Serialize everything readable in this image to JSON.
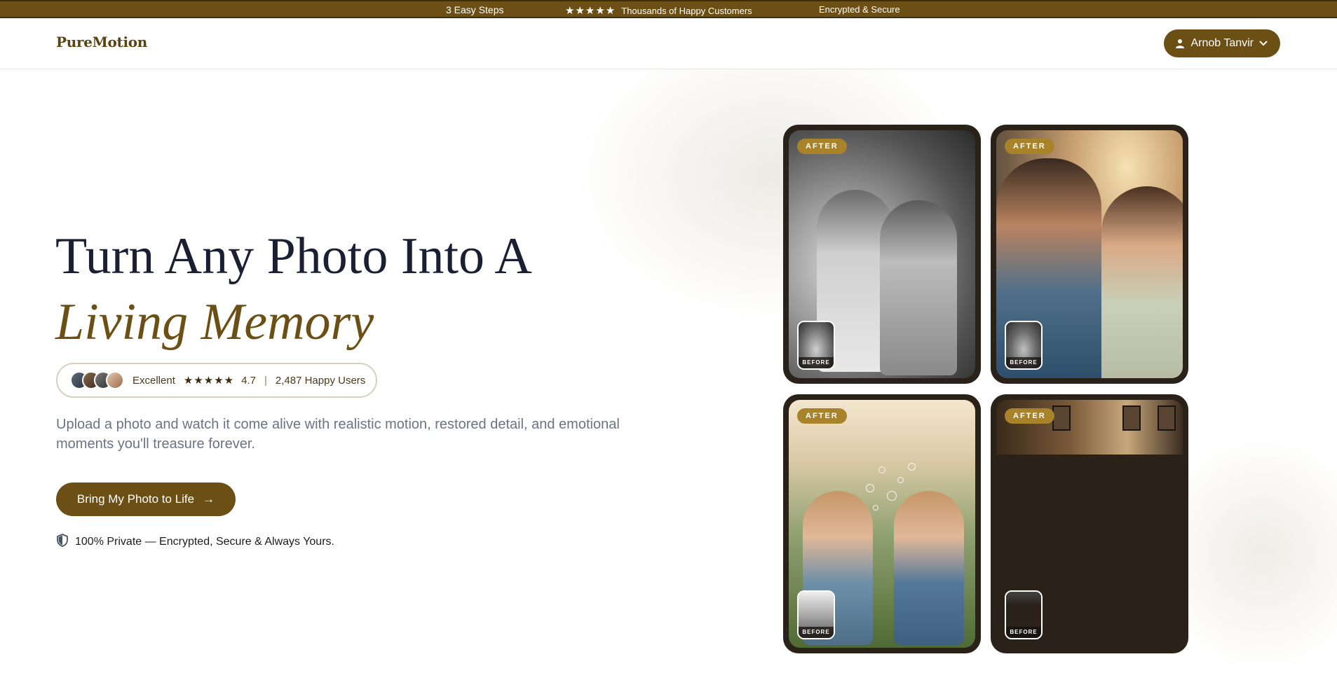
{
  "topbar": {
    "steps": "3 Easy Steps",
    "stars": "★★★★★",
    "customers": "Thousands of Happy Customers",
    "secure": "Encrypted & Secure"
  },
  "header": {
    "logo": "PureMotion",
    "user_name": "Arnob Tanvir"
  },
  "hero": {
    "headline_line1": "Turn Any Photo Into A",
    "headline_line2": "Living Memory",
    "rating": {
      "label": "Excellent",
      "stars": "★★★★★",
      "value": "4.7",
      "separator": "|",
      "users": "2,487 Happy Users"
    },
    "description": "Upload a photo and watch it come alive with realistic motion, restored detail, and emotional moments you'll treasure forever.",
    "cta_label": "Bring My Photo to Life",
    "cta_arrow": "→",
    "privacy": "100% Private — Encrypted, Secure & Always Yours."
  },
  "gallery": {
    "cards": [
      {
        "after_label": "AFTER",
        "before_label": "BEFORE"
      },
      {
        "after_label": "AFTER",
        "before_label": "BEFORE"
      },
      {
        "after_label": "AFTER",
        "before_label": "BEFORE"
      },
      {
        "after_label": "AFTER",
        "before_label": "BEFORE"
      }
    ]
  },
  "colors": {
    "brand": "#6b4f14",
    "badge": "#a9832a",
    "headline": "#1a1f33",
    "card_bg": "#2a2119"
  },
  "icons": {
    "user": "user-icon",
    "chevron": "chevron-down-icon",
    "shield": "shield-icon",
    "arrow": "arrow-right-icon"
  }
}
